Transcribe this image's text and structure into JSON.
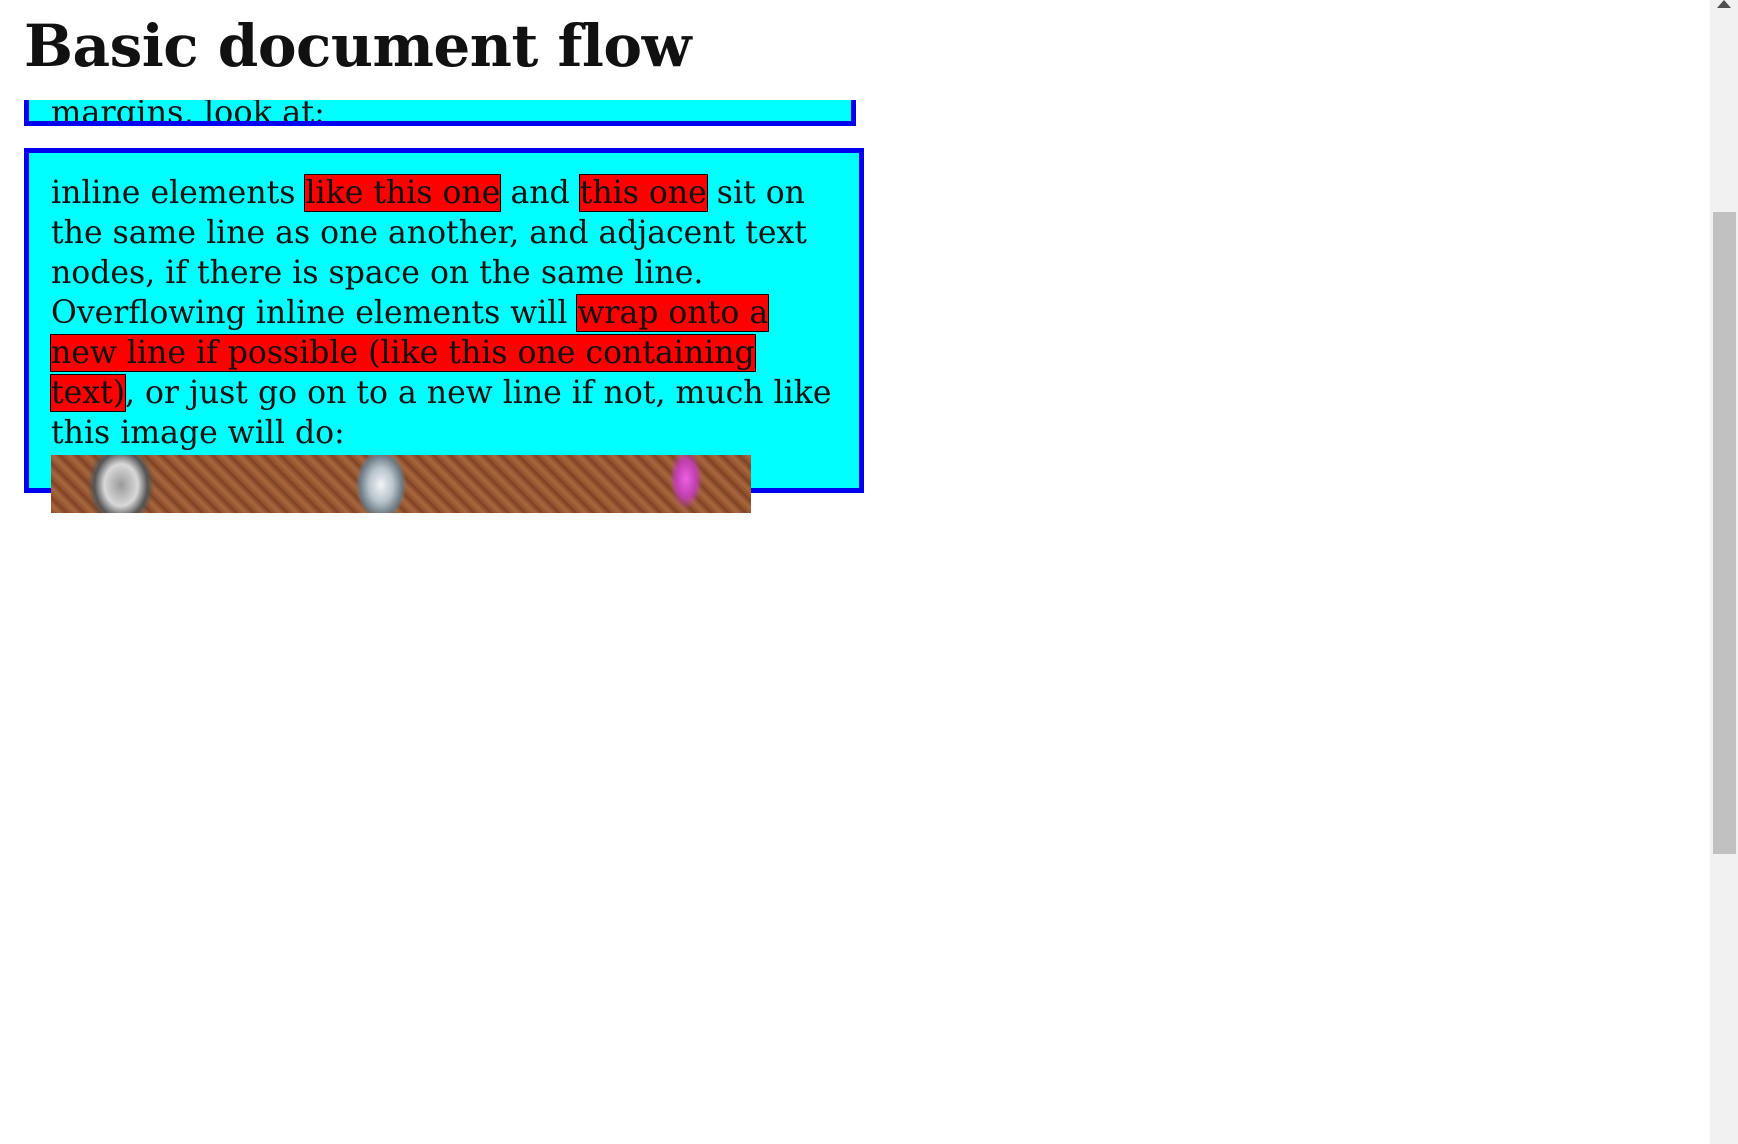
{
  "page": {
    "heading": "Basic document flow",
    "previous_block_fragment": "margins, look at:"
  },
  "inline_paragraph": {
    "intro": "inline elements ",
    "span1": "like this one",
    "joiner": " and ",
    "span2": "this one",
    "middle": " sit on the same line as one another, and adjacent text nodes, if there is space on the same line. Overflowing inline elements will ",
    "span3": "wrap onto a new line if possible (like this one containing text)",
    "outro": ", or just go on to a new line if not, much like this image will do:"
  },
  "image": {
    "description_icon": "image-icon"
  },
  "colors": {
    "box_background": "#00ffff",
    "box_border": "#0000ee",
    "inline_highlight": "#ff0000",
    "scrollbar_track": "#f1f1f1",
    "scrollbar_thumb": "#c1c1c1"
  },
  "scrollbar": {
    "icon": "chevron-up-icon"
  }
}
